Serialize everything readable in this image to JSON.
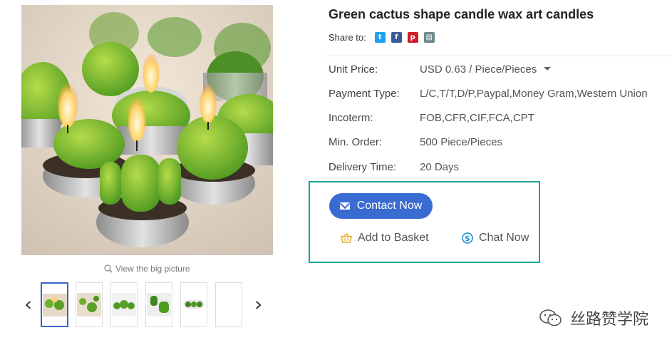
{
  "product": {
    "title": "Green cactus shape candle wax art candles",
    "share_label": "Share to:",
    "share_icons": [
      {
        "name": "twitter-icon",
        "color": "#1da1f2"
      },
      {
        "name": "facebook-icon",
        "color": "#3b5998"
      },
      {
        "name": "pinterest-icon",
        "color": "#cb2027"
      },
      {
        "name": "message-icon",
        "color": "#6a8a8a"
      }
    ],
    "view_big_picture": "View the big picture",
    "specs": [
      {
        "label": "Unit Price:",
        "value": "USD 0.63 / Piece/Pieces"
      },
      {
        "label": "Payment Type:",
        "value": "L/C,T/T,D/P,Paypal,Money Gram,Western Union"
      },
      {
        "label": "Incoterm:",
        "value": "FOB,CFR,CIF,FCA,CPT"
      },
      {
        "label": "Min. Order:",
        "value": "500 Piece/Pieces"
      },
      {
        "label": "Delivery Time:",
        "value": "20 Days"
      }
    ]
  },
  "actions": {
    "contact_now": "Contact Now",
    "add_to_basket": "Add to Basket",
    "chat_now": "Chat Now"
  },
  "thumbnails": {
    "count": 6,
    "active_index": 0
  },
  "watermark": {
    "text": "丝路赞学院"
  },
  "colors": {
    "accent_blue": "#3a6bd1",
    "highlight_box": "#1aa39a",
    "basket_icon": "#e5a823",
    "skype_icon": "#1a8fd8"
  }
}
